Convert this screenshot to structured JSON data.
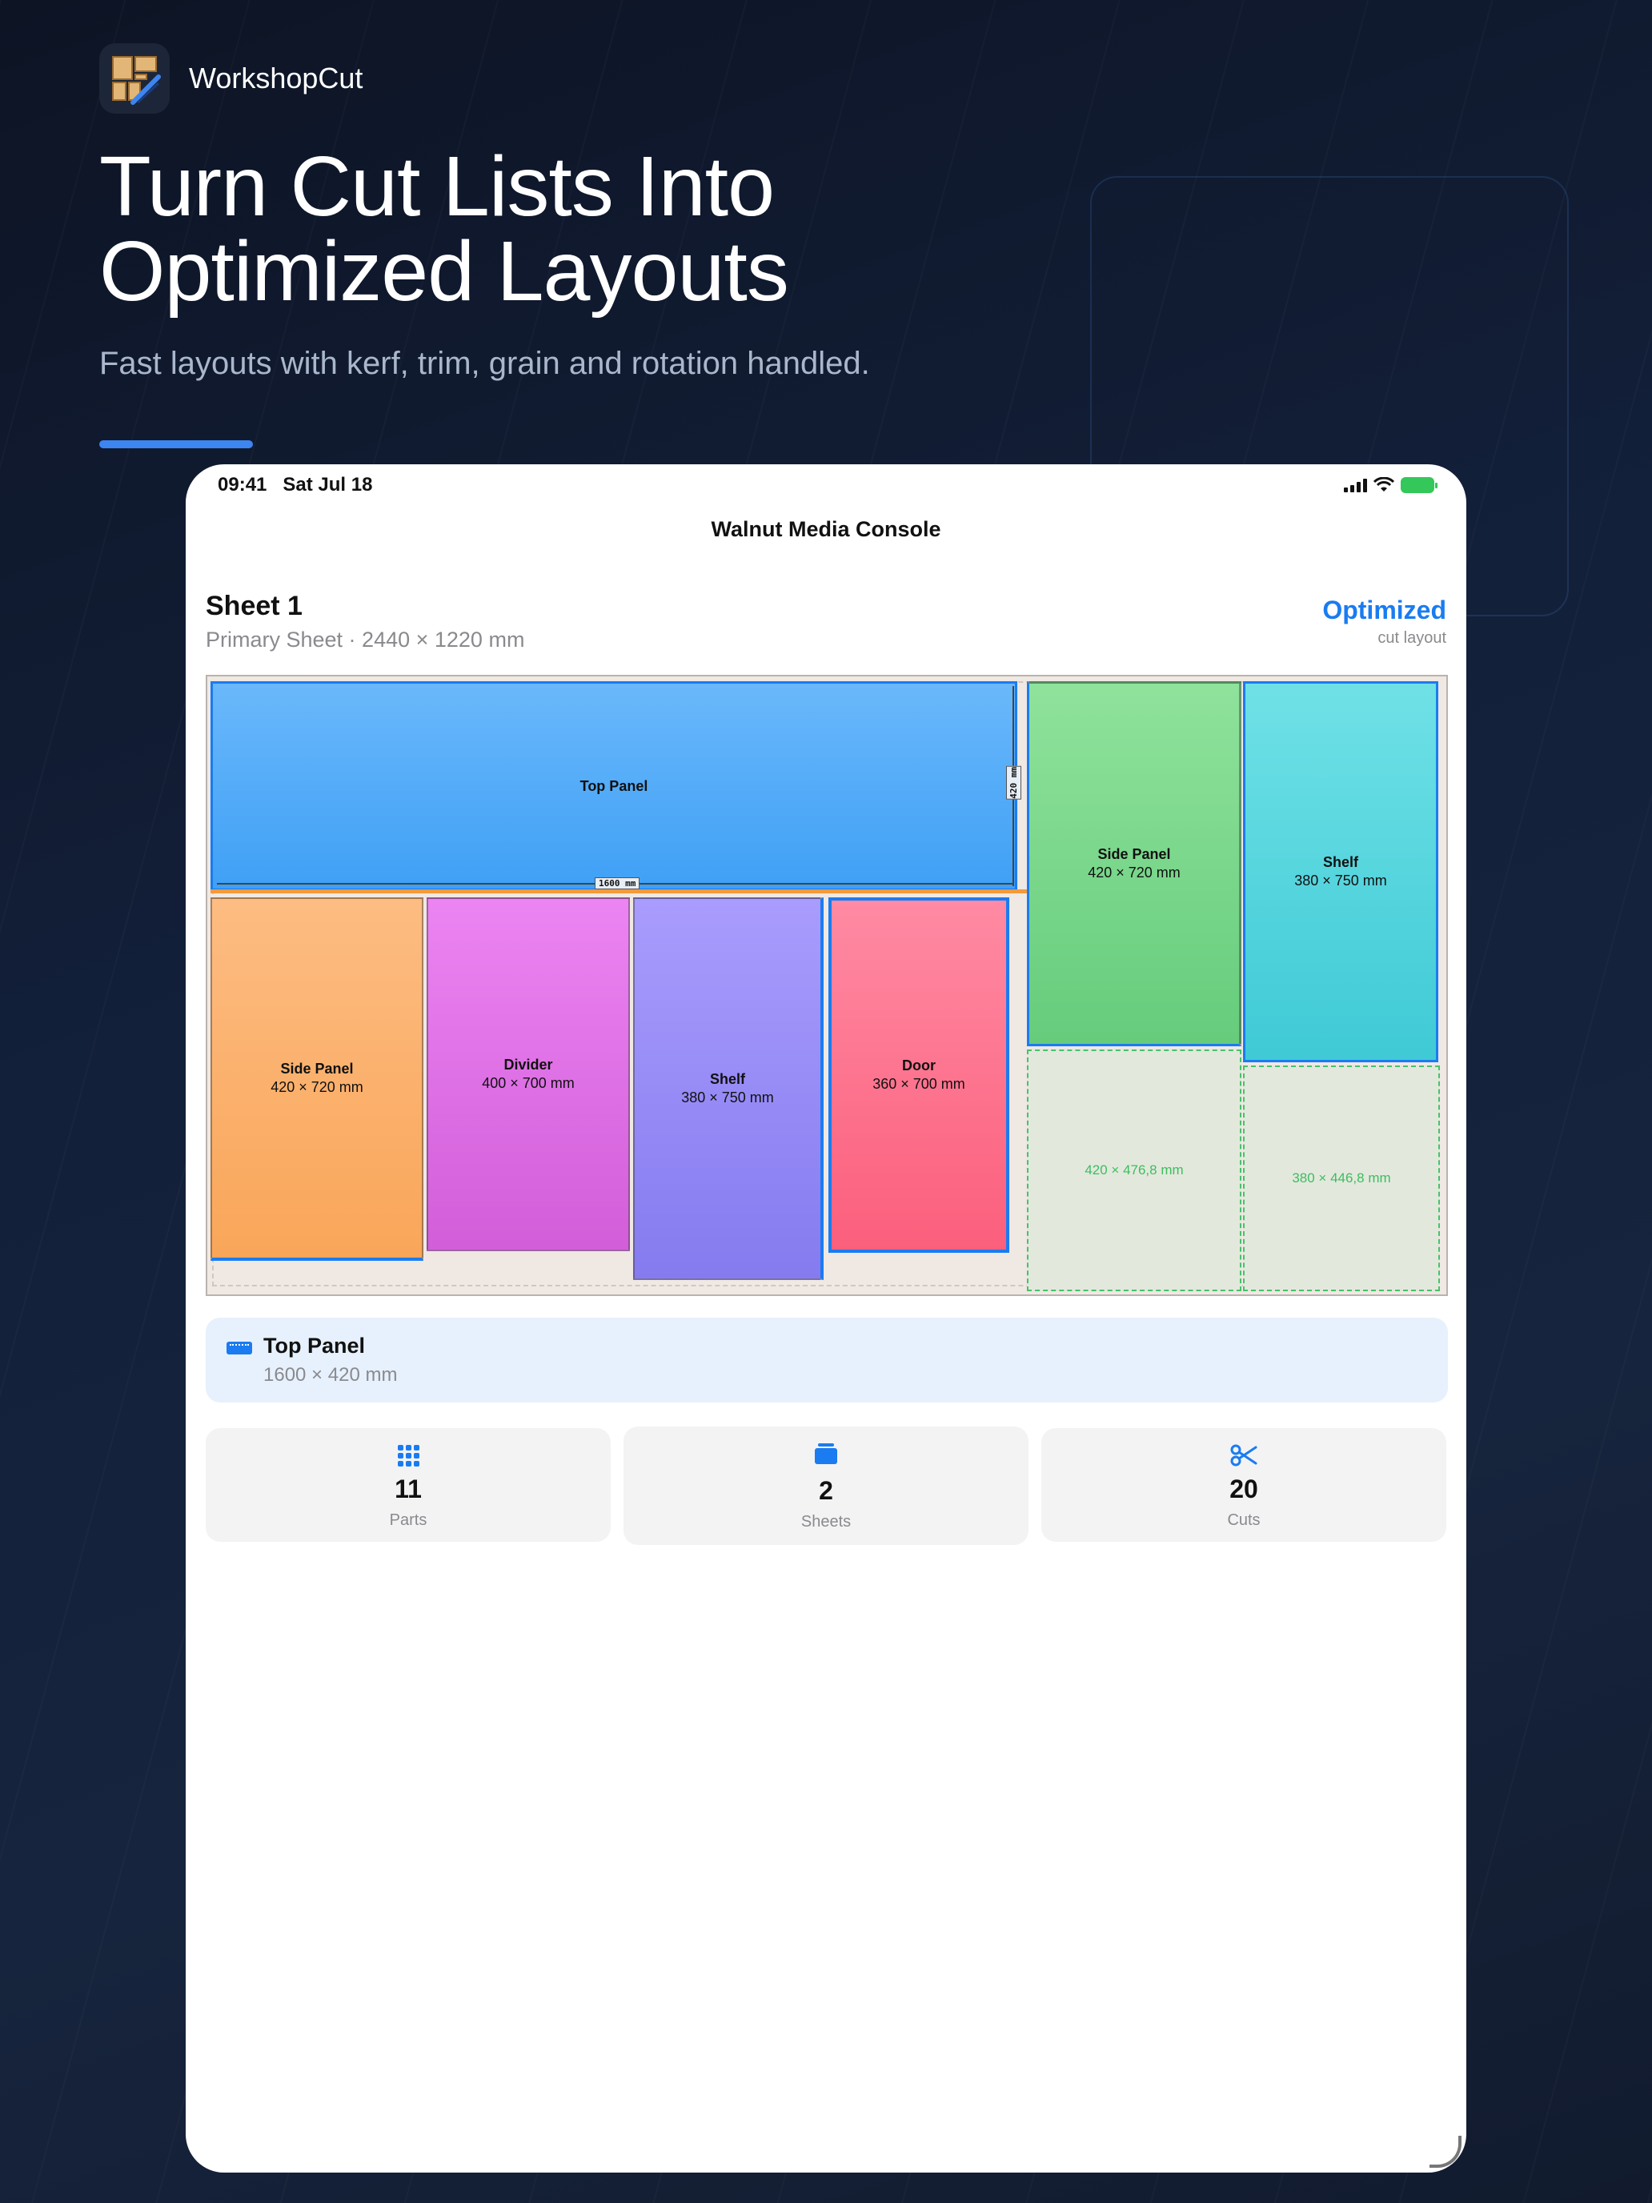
{
  "brand": {
    "name": "WorkshopCut",
    "icon": "app-icon"
  },
  "headline": {
    "line1": "Turn Cut Lists Into",
    "line2": "Optimized Layouts"
  },
  "subhead": "Fast layouts with kerf, trim, grain and rotation handled.",
  "status_bar": {
    "time": "09:41",
    "date": "Sat Jul 18"
  },
  "nav": {
    "title": "Walnut Media Console"
  },
  "sheet": {
    "title": "Sheet 1",
    "subtitle": "Primary Sheet · 2440 × 1220 mm",
    "status": "Optimized",
    "status_sub": "cut layout"
  },
  "board": {
    "pieces": [
      {
        "name": "Top Panel",
        "dims": "",
        "color": "#4aa3f7"
      },
      {
        "name": "Side Panel",
        "dims": "420 × 720 mm",
        "color": "#fbb06c"
      },
      {
        "name": "Divider",
        "dims": "400 × 700 mm",
        "color": "#dd6fe4"
      },
      {
        "name": "Shelf",
        "dims": "380 × 750 mm",
        "color": "#9389f4"
      },
      {
        "name": "Door",
        "dims": "360 × 700 mm",
        "color": "#fd6d88"
      },
      {
        "name": "Side Panel",
        "dims": "420 × 720 mm",
        "color": "#76d68a"
      },
      {
        "name": "Shelf",
        "dims": "380 × 750 mm",
        "color": "#4fd3dc"
      }
    ],
    "offcuts": [
      "420 × 476,8 mm",
      "380 × 446,8 mm"
    ],
    "dimension_labels": {
      "width": "1600 mm",
      "height": "420 mm"
    }
  },
  "selected": {
    "name": "Top Panel",
    "dims": "1600 × 420 mm",
    "icon": "ruler-icon"
  },
  "stats": [
    {
      "value": "11",
      "label": "Parts",
      "icon": "grid-icon"
    },
    {
      "value": "2",
      "label": "Sheets",
      "icon": "stack-icon"
    },
    {
      "value": "20",
      "label": "Cuts",
      "icon": "scissors-icon"
    }
  ],
  "colors": {
    "accent": "#1a7cf0",
    "offcut": "#3cbe61",
    "background": "#121b2e"
  }
}
